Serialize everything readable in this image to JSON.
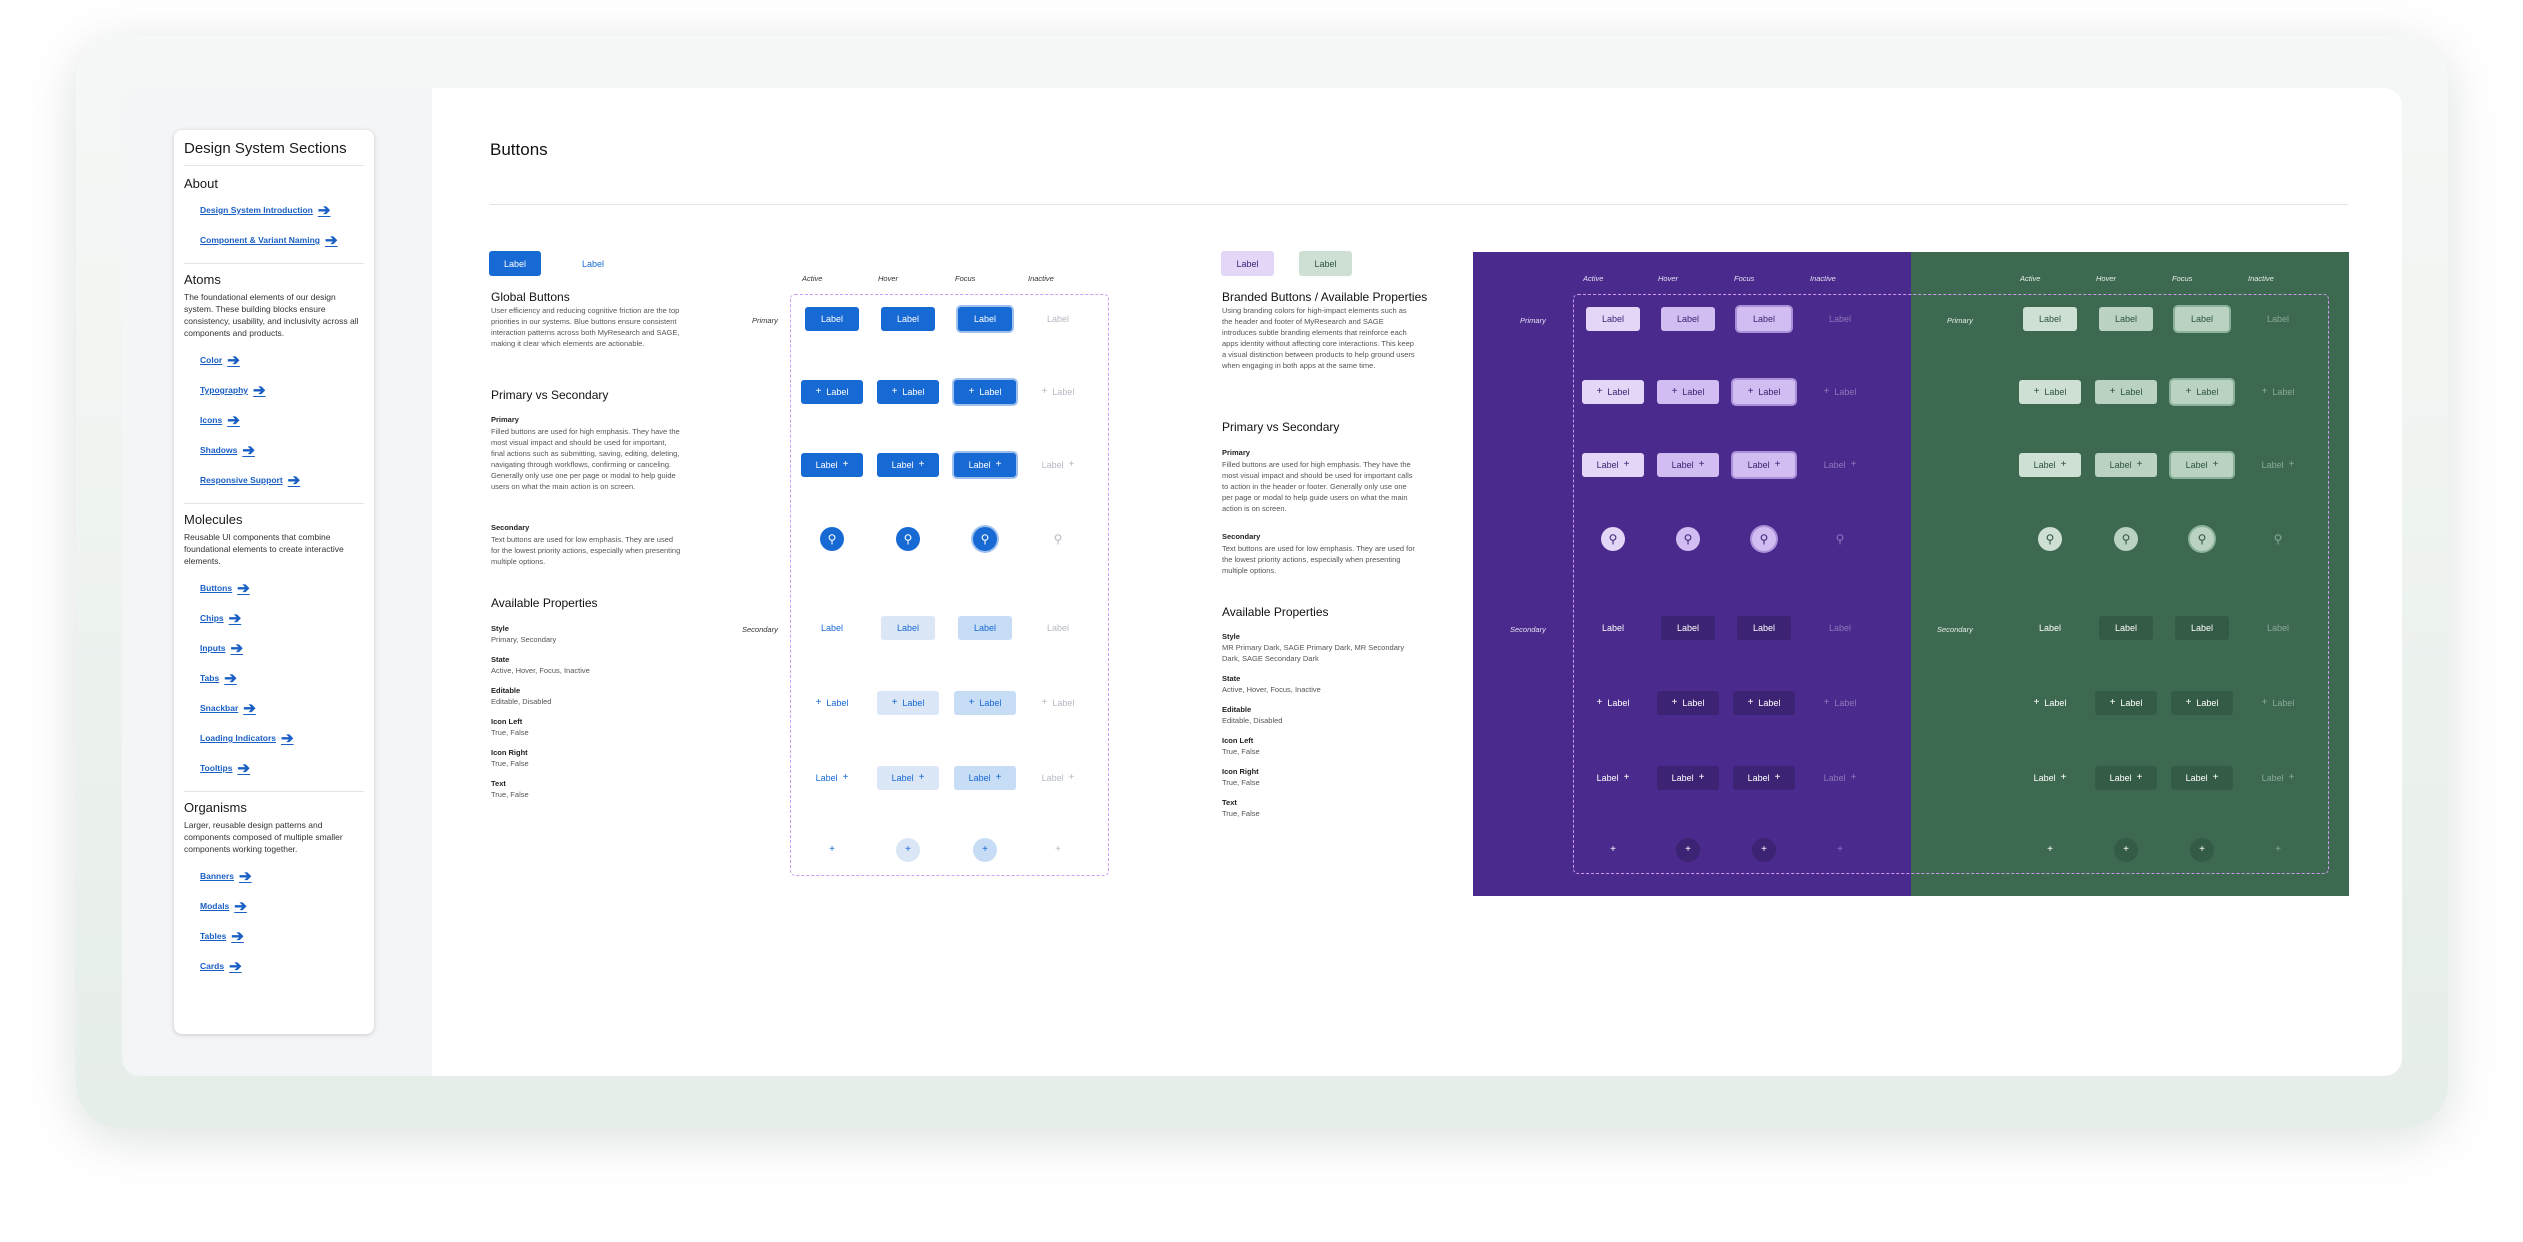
{
  "sidebar": {
    "title": "Design System Sections",
    "about": {
      "heading": "About",
      "links": [
        "Design System Introduction",
        "Component & Variant Naming"
      ]
    },
    "atoms": {
      "heading": "Atoms",
      "desc": "The foundational elements of our design system. These building blocks ensure consistency, usability, and inclusivity across all components and products.",
      "links": [
        "Color",
        "Typography",
        "Icons",
        "Shadows",
        "Responsive Support"
      ]
    },
    "molecules": {
      "heading": "Molecules",
      "desc": "Reusable UI components that combine foundational elements to create interactive elements.",
      "links": [
        "Buttons",
        "Chips",
        "Inputs",
        "Tabs",
        "Snackbar",
        "Loading Indicators",
        "Tooltips"
      ]
    },
    "organisms": {
      "heading": "Organisms",
      "desc": "Larger, reusable design patterns and components composed of multiple smaller components working together.",
      "links": [
        "Banners",
        "Modals",
        "Tables",
        "Cards"
      ]
    }
  },
  "page": {
    "title": "Buttons"
  },
  "global": {
    "sample_primary": "Label",
    "sample_secondary": "Label",
    "heading": "Global Buttons",
    "desc": "User efficiency and reducing cognitive friction are the top priorities in our systems. Blue buttons ensure consistent interaction patterns across both MyResearch and SAGE, making it clear which elements are actionable.",
    "pvs_heading": "Primary vs Secondary",
    "primary_label": "Primary",
    "primary_desc": "Filled buttons are used for high emphasis. They have the most visual impact and should be used for important, final actions such as submitting, saving, editing, deleting, navigating through workflows, confirming or canceling. Generally only use one per page or modal to help guide users on what the main action is on screen.",
    "secondary_label": "Secondary",
    "secondary_desc": "Text buttons are used for low emphasis. They are used for the lowest priority actions, especially when presenting multiple options.",
    "props_heading": "Available Properties",
    "props": [
      {
        "name": "Style",
        "value": "Primary, Secondary"
      },
      {
        "name": "State",
        "value": "Active, Hover, Focus, Inactive"
      },
      {
        "name": "Editable",
        "value": "Editable, Disabled"
      },
      {
        "name": "Icon Left",
        "value": "True, False"
      },
      {
        "name": "Icon Right",
        "value": "True, False"
      },
      {
        "name": "Text",
        "value": "True, False"
      }
    ]
  },
  "branded": {
    "sample_purple": "Label",
    "sample_green": "Label",
    "heading": "Branded Buttons / Available Properties",
    "desc": "Using branding colors for high-impact elements such as the header and footer of MyResearch and SAGE introduces subtle branding elements that reinforce each apps identity without affecting core interactions. This keep a visual distinction between products to help ground users when engaging in both apps at the same time.",
    "pvs_heading": "Primary vs Secondary",
    "primary_label": "Primary",
    "primary_desc": "Filled buttons are used for high emphasis. They have the most visual impact and should be used for important calls to action in the header or footer. Generally only use one per page or modal to help guide users on what the main action is on screen.",
    "secondary_label": "Secondary",
    "secondary_desc": "Text buttons are used for low emphasis. They are used for the lowest priority actions, especially when presenting multiple options.",
    "props_heading": "Available Properties",
    "props": [
      {
        "name": "Style",
        "value": "MR Primary Dark, SAGE Primary Dark, MR Secondary Dark, SAGE Secondary Dark"
      },
      {
        "name": "State",
        "value": "Active, Hover, Focus, Inactive"
      },
      {
        "name": "Editable",
        "value": "Editable, Disabled"
      },
      {
        "name": "Icon Left",
        "value": "True, False"
      },
      {
        "name": "Icon Right",
        "value": "True, False"
      },
      {
        "name": "Text",
        "value": "True, False"
      }
    ]
  },
  "matrix": {
    "columns": [
      "Active",
      "Hover",
      "Focus",
      "Inactive"
    ],
    "row_primary": "Primary",
    "row_secondary": "Secondary",
    "button_label": "Label"
  },
  "icons": {
    "plus": "+",
    "search": "⚲",
    "arrow": "➔"
  },
  "colors": {
    "blue": "#1769d4",
    "purple": "#4a2a8c",
    "green": "#3e6951",
    "dashed_border": "#cf9af2"
  }
}
